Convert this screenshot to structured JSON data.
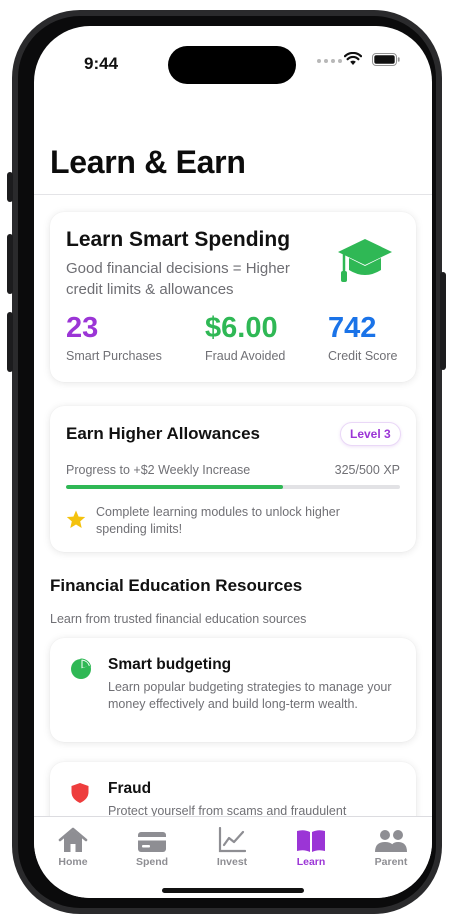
{
  "status": {
    "time": "9:44"
  },
  "page": {
    "title": "Learn & Earn"
  },
  "smart_spending": {
    "title": "Learn Smart Spending",
    "subtitle": "Good financial decisions = Higher credit limits & allowances",
    "icon": "graduation-cap-icon",
    "stats": [
      {
        "value": "23",
        "label": "Smart Purchases",
        "color": "#9b35d6"
      },
      {
        "value": "$6.00",
        "label": "Fraud Avoided",
        "color": "#2fb855"
      },
      {
        "value": "742",
        "label": "Credit Score",
        "color": "#1a73e8"
      }
    ]
  },
  "allowances": {
    "title": "Earn Higher Allowances",
    "level": "Level 3",
    "progress_label": "Progress to +$2 Weekly Increase",
    "progress_text": "325/500 XP",
    "progress_fraction": 0.65,
    "note": "Complete learning modules to unlock higher spending limits!"
  },
  "resources": {
    "title": "Financial Education Resources",
    "subtitle": "Learn from trusted financial education sources",
    "items": [
      {
        "title": "Smart budgeting",
        "description": "Learn popular budgeting strategies to manage your money effectively and build long-term wealth.",
        "icon": "pie-chart-icon"
      },
      {
        "title": "Fraud",
        "description": "Protect yourself from scams and fraudulent activities. Learn how to identify and avoid",
        "icon": "shield-icon"
      }
    ]
  },
  "tabs": [
    {
      "label": "Home",
      "icon": "house-icon"
    },
    {
      "label": "Spend",
      "icon": "credit-card-icon"
    },
    {
      "label": "Invest",
      "icon": "chart-line-icon"
    },
    {
      "label": "Learn",
      "icon": "book-icon",
      "active": true
    },
    {
      "label": "Parent",
      "icon": "people-icon"
    }
  ],
  "colors": {
    "purple": "#9b35d6",
    "green": "#2fb855",
    "blue": "#1a73e8",
    "red": "#ee3d3d",
    "gold": "#f4c20d"
  }
}
